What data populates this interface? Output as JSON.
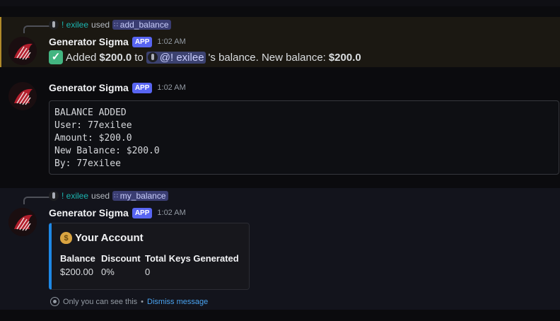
{
  "top_cut": {
    "left_text": "only you can see this",
    "right_text": "Dismiss message"
  },
  "messages": [
    {
      "reply": {
        "user": "! exilee",
        "used": "used",
        "command": "add_balance"
      },
      "author": "Generator Sigma",
      "badge": "APP",
      "time": "1:02 AM",
      "content": {
        "prefix": "Added",
        "amount": "$200.0",
        "to": "to",
        "mention": "@! exilee",
        "suffix": "'s balance. New balance:",
        "new_balance": "$200.0"
      }
    },
    {
      "author": "Generator Sigma",
      "badge": "APP",
      "time": "1:02 AM",
      "code_lines": [
        "BALANCE ADDED",
        "User: 77exilee",
        "Amount: $200.0",
        "New Balance: $200.0",
        "By: 77exilee"
      ]
    },
    {
      "reply": {
        "user": "! exilee",
        "used": "used",
        "command": "my_balance"
      },
      "author": "Generator Sigma",
      "badge": "APP",
      "time": "1:02 AM",
      "embed": {
        "title": "Your Account",
        "fields": [
          {
            "name": "Balance",
            "value": "$200.00"
          },
          {
            "name": "Discount",
            "value": "0%"
          },
          {
            "name": "Total Keys Generated",
            "value": "0"
          }
        ],
        "accent": "#1e88e5"
      },
      "ephemeral": {
        "note": "Only you can see this",
        "separator": "•",
        "dismiss": "Dismiss message"
      }
    }
  ],
  "icons": {
    "check": "check-mark-icon",
    "command": "slash-command-icon",
    "money_bag": "money-bag-icon",
    "eye": "eye-icon"
  },
  "colors": {
    "app_badge": "#5865f2",
    "embed_accent": "#1e88e5",
    "link": "#4aa3f0",
    "username": "#1bb5b0"
  }
}
